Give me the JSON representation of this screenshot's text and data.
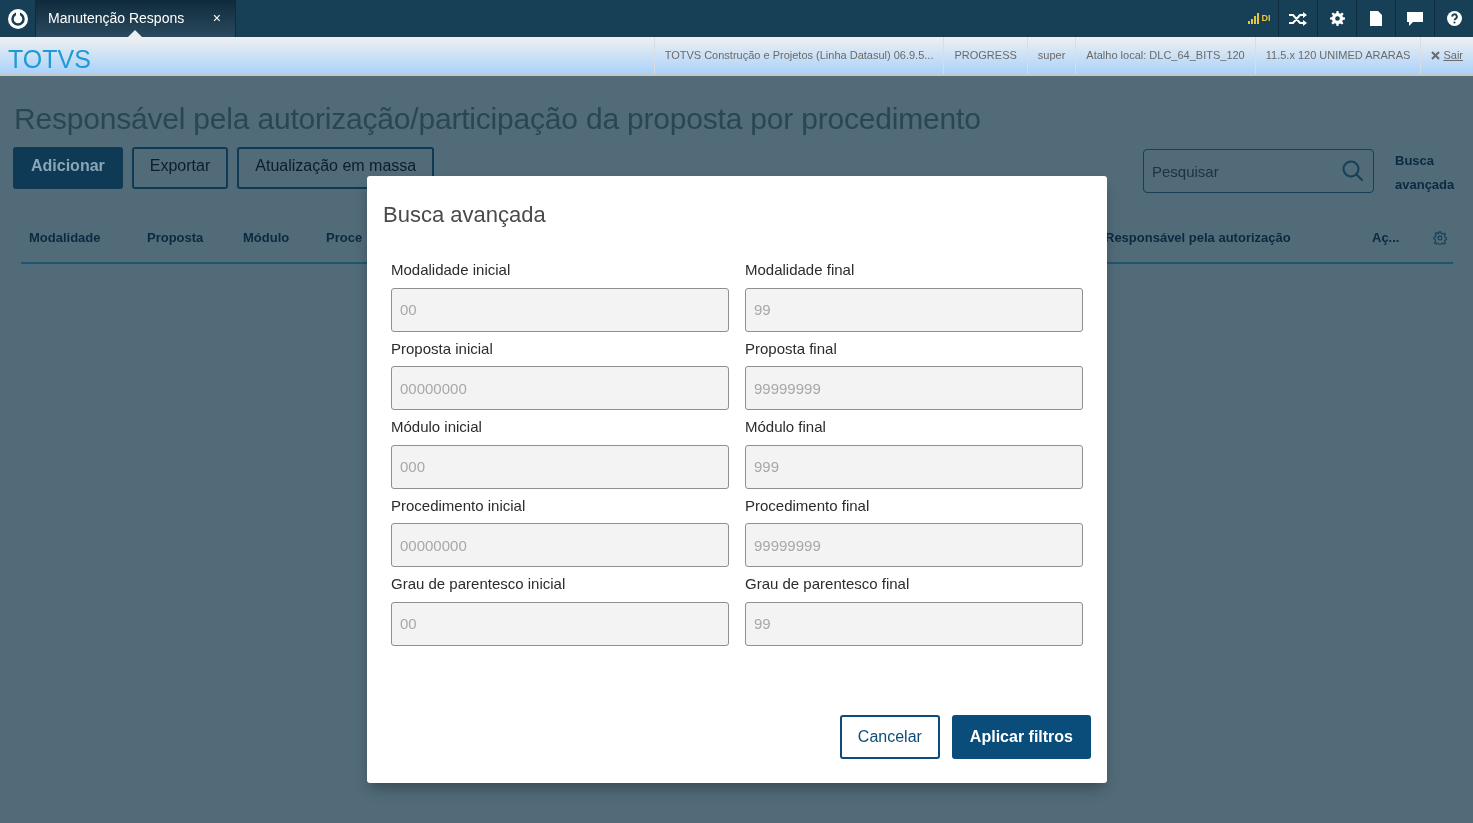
{
  "app_tab": {
    "title": "Manutenção Respons",
    "close": "×",
    "selected": true
  },
  "toolbar": {
    "connection": "DI"
  },
  "header": {
    "brand": "TOTVS",
    "info": [
      "TOTVS Construção e Projetos (Linha Datasul) 06.9.5...",
      "PROGRESS",
      "super",
      "Atalho local: DLC_64_BITS_120",
      "11.5.x 120 UNIMED ARARAS"
    ],
    "logout": "Sair"
  },
  "page": {
    "title": "Responsável pela autorização/participação da proposta por procedimento",
    "actions": [
      {
        "label": "Adicionar",
        "kind": "primary"
      },
      {
        "label": "Exportar",
        "kind": "outline"
      },
      {
        "label": "Atualização em massa",
        "kind": "outline"
      }
    ],
    "search": {
      "placeholder": "Pesquisar"
    },
    "advanced_search": "Busca avançada",
    "columns": [
      "Modalidade",
      "Proposta",
      "Módulo",
      "Proce",
      "Responsável pela autorização",
      "Aç..."
    ]
  },
  "modal": {
    "title": "Busca avançada",
    "fields": [
      {
        "label": "Modalidade inicial",
        "placeholder": "00"
      },
      {
        "label": "Modalidade final",
        "placeholder": "99"
      },
      {
        "label": "Proposta inicial",
        "placeholder": "00000000"
      },
      {
        "label": "Proposta final",
        "placeholder": "99999999"
      },
      {
        "label": "Módulo inicial",
        "placeholder": "000"
      },
      {
        "label": "Módulo final",
        "placeholder": "999"
      },
      {
        "label": "Procedimento inicial",
        "placeholder": "00000000"
      },
      {
        "label": "Procedimento final",
        "placeholder": "99999999"
      },
      {
        "label": "Grau de parentesco inicial",
        "placeholder": "00"
      },
      {
        "label": "Grau de parentesco final",
        "placeholder": "99"
      }
    ],
    "buttons": [
      {
        "label": "Cancelar",
        "kind": "outline"
      },
      {
        "label": "Aplicar filtros",
        "kind": "primary"
      }
    ]
  }
}
